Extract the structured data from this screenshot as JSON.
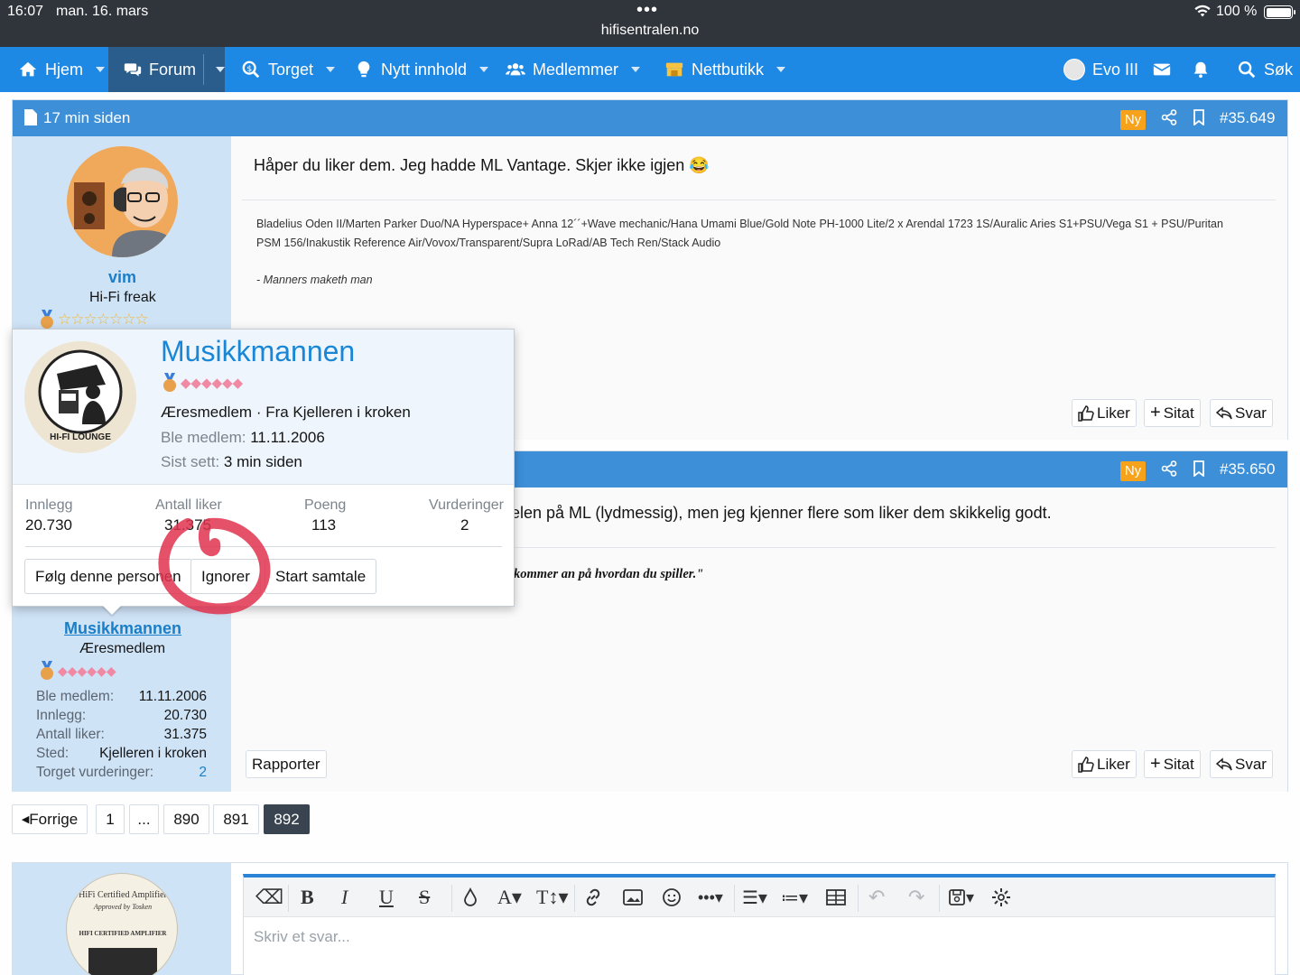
{
  "status_bar": {
    "time": "16:07",
    "date": "man. 16. mars",
    "url": "hifisentralen.no",
    "battery": "100 %",
    "dots": "•••"
  },
  "nav": {
    "home": "Hjem",
    "forum": "Forum",
    "market": "Torget",
    "new_content": "Nytt innhold",
    "members": "Medlemmer",
    "shop": "Nettbutikk",
    "user": "Evo III",
    "search": "Søk"
  },
  "post1": {
    "time": "17 min siden",
    "badge": "Ny",
    "number": "#35.649",
    "message": "Håper du liker dem. Jeg hadde ML Vantage. Skjer ikke igjen",
    "emoji": "😂",
    "signature_line1": "Bladelius Oden II/Marten Parker Duo/NA Hyperspace+ Anna 12´´+Wave mechanic/Hana Umami Blue/Gold Note PH-1000 Lite/2 x Arendal 1723 1S/Auralic Aries S1+PSU/Vega S1 + PSU/Puritan",
    "signature_line2": "PSM 156/Inakustik Reference Air/Vovox/Transparent/Supra LoRad/AB Tech Ren/Stack Audio",
    "signature_quote": "- Manners maketh man",
    "author": "vim",
    "author_title": "Hi-Fi freak",
    "like": "Liker",
    "quote": "Sitat",
    "reply": "Svar"
  },
  "post2": {
    "badge": "Ny",
    "number": "#35.650",
    "message_fragment": "elen på ML (lydmessig), men jeg kjenner flere som liker dem skikkelig godt.",
    "signature_fragment": "kommer an på hvordan du spiller.\"",
    "author": "Musikkmannen",
    "author_title": "Æresmedlem",
    "info": [
      {
        "label": "Ble medlem:",
        "value": "11.11.2006"
      },
      {
        "label": "Innlegg:",
        "value": "20.730"
      },
      {
        "label": "Antall liker:",
        "value": "31.375"
      },
      {
        "label": "Sted:",
        "value": "Kjelleren i kroken"
      },
      {
        "label": "Torget vurderinger:",
        "value": "2"
      }
    ],
    "report": "Rapporter",
    "like": "Liker",
    "quote": "Sitat",
    "reply": "Svar"
  },
  "member_card": {
    "name": "Musikkmannen",
    "avatar_text": "HI-FI LOUNGE",
    "title": "Æresmedlem",
    "location": "Fra Kjelleren i kroken",
    "joined_label": "Ble medlem:",
    "joined_value": "11.11.2006",
    "seen_label": "Sist sett:",
    "seen_value": "3 min siden",
    "stats": [
      {
        "label": "Innlegg",
        "value": "20.730"
      },
      {
        "label": "Antall liker",
        "value": "31.375"
      },
      {
        "label": "Poeng",
        "value": "113"
      },
      {
        "label": "Vurderinger",
        "value": "2"
      }
    ],
    "follow": "Følg denne personen",
    "ignore": "Ignorer",
    "start_conversation": "Start samtale"
  },
  "pagination": {
    "prev": "Forrige",
    "pages": [
      "1",
      "...",
      "890",
      "891",
      "892"
    ],
    "current": "892"
  },
  "editor": {
    "placeholder": "Skriv et svar...",
    "avatar_text_1": "HiFi Certified Amplifier",
    "avatar_text_2": "Approved by Tosken",
    "avatar_text_3": "HIFI CERTIFIED AMPLIFIER"
  },
  "colors": {
    "nav": "#1e88e5",
    "post_header": "#3d8fd8",
    "user_pane": "#cfe3f7",
    "new_badge": "#f7a21b",
    "annotation": "#e0334f"
  }
}
